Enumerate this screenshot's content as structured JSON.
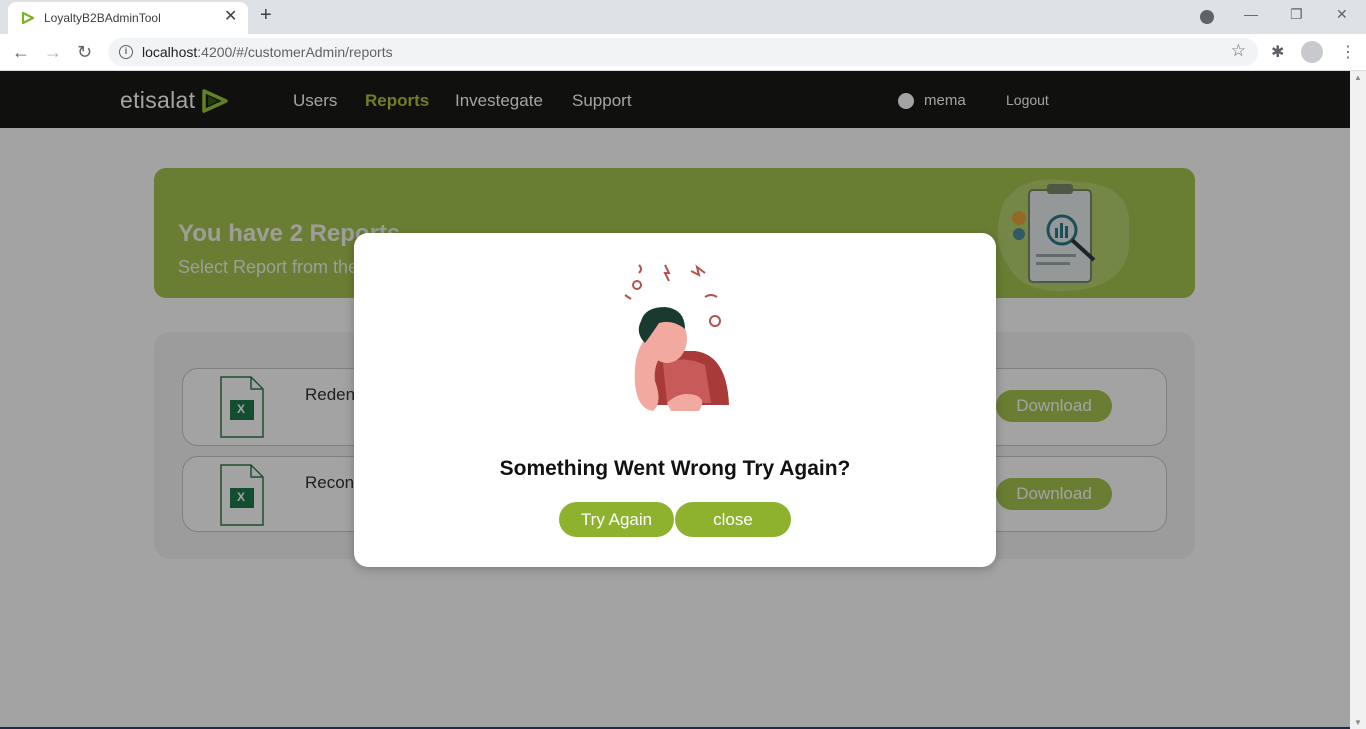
{
  "browser": {
    "tab_title": "LoyaltyB2BAdminTool",
    "tab_close": "✕",
    "new_tab": "+",
    "url_host": "localhost",
    "url_rest": ":4200/#/customerAdmin/reports",
    "back": "←",
    "forward": "→",
    "reload": "↻",
    "star": "☆",
    "extensions": "✱",
    "menu": "⋮",
    "minimize": "—",
    "restore": "❐",
    "close": "✕"
  },
  "header": {
    "logo": "etisalat",
    "nav": [
      "Users",
      "Reports",
      "Investegate",
      "Support"
    ],
    "active_nav": "Reports",
    "user": "mema",
    "logout": "Logout"
  },
  "banner": {
    "heading": "You have 2 Reports",
    "sub": "Select Report from the"
  },
  "reports": [
    {
      "name": "Reden",
      "button": "Download",
      "file_label": "X"
    },
    {
      "name": "Recon",
      "button": "Download",
      "file_label": "X"
    }
  ],
  "modal": {
    "message": "Something Went Wrong Try Again?",
    "try_again": "Try Again",
    "close": "close"
  },
  "colors": {
    "brand_green": "#a6c550",
    "button_green": "#8eb22d",
    "nav_bg": "#1a1c16",
    "active_nav": "#b6c23a"
  }
}
